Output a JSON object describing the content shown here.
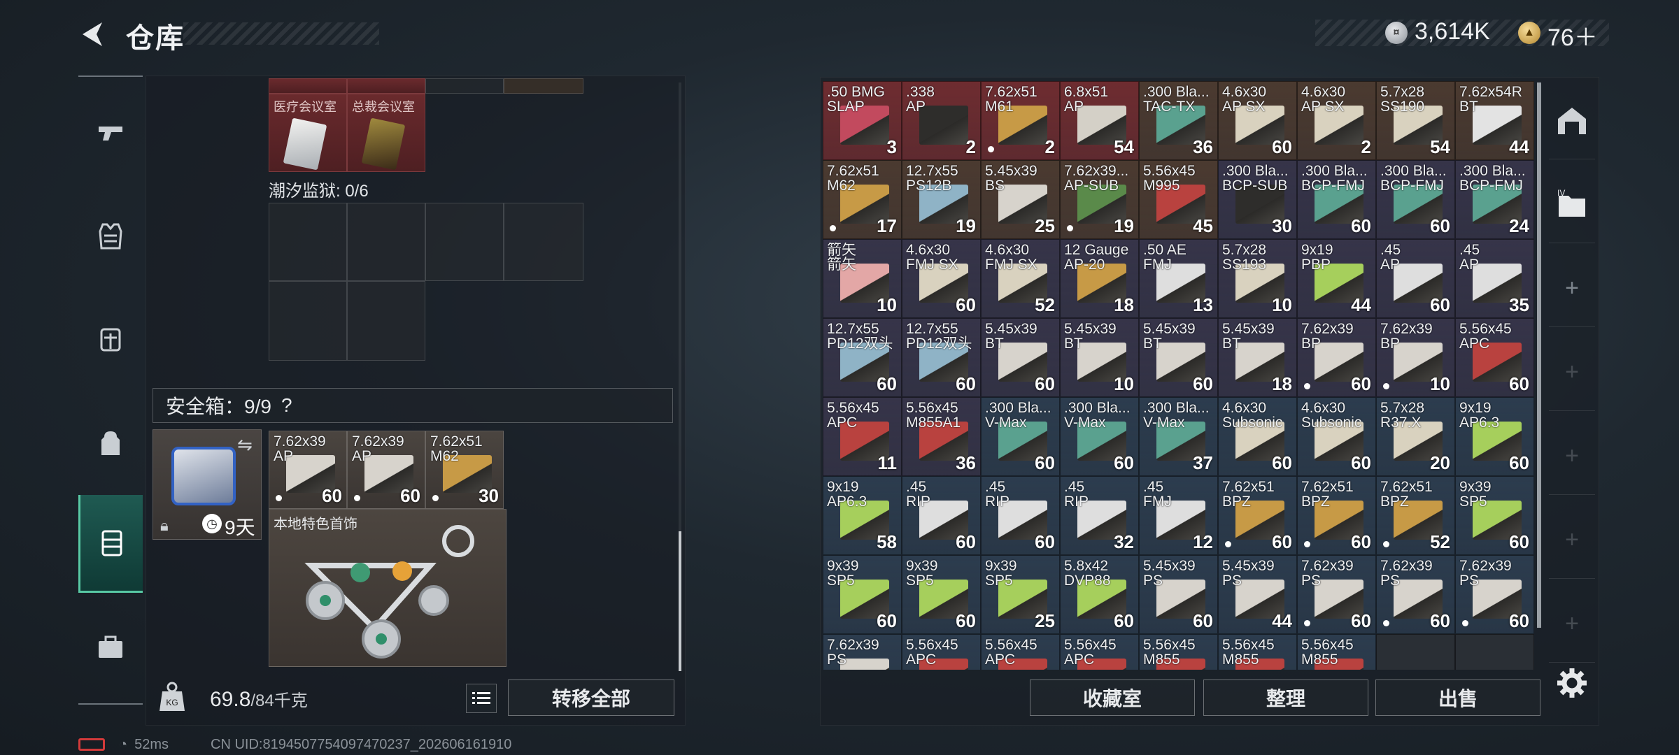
{
  "header": {
    "title": "仓库",
    "silver_value": "3,614K",
    "gold_value": "76＋"
  },
  "left": {
    "rooms": [
      {
        "label": "医疗会议室"
      },
      {
        "label": "总裁会议室"
      }
    ],
    "prison_label": "潮汐监狱: 0/6",
    "safebox_label": "安全箱：9/9",
    "safebox_help": "?",
    "safebox_timer": "9天",
    "safebox_items": [
      {
        "name": "7.62x39\nAP",
        "count": "60",
        "dot": true,
        "color": "#d7d3cc"
      },
      {
        "name": "7.62x39\nAP",
        "count": "60",
        "dot": true,
        "color": "#d7d3cc"
      },
      {
        "name": "7.62x51\nM62",
        "count": "30",
        "dot": true,
        "color": "#c79a46"
      }
    ],
    "trinket_label": "本地特色首饰",
    "weight_value": "69.8",
    "weight_max": "/84千克",
    "transfer_all": "转移全部"
  },
  "stash": {
    "rows": [
      [
        {
          "name": ".50 BMG\nSLAP",
          "count": "3",
          "bg": "#6e2c30",
          "box": "#c24a5e",
          "dot": false
        },
        {
          "name": ".338\nAP",
          "count": "2",
          "bg": "#6e2c30",
          "box": "#2e2d2b",
          "dot": false
        },
        {
          "name": "7.62x51\nM61",
          "count": "2",
          "bg": "#6e2c30",
          "box": "#c79a46",
          "dot": true
        },
        {
          "name": "6.8x51\nAP",
          "count": "54",
          "bg": "#6e2c30",
          "box": "#d4d0c7",
          "dot": false
        },
        {
          "name": ".300 Bla...\nTAC-TX",
          "count": "36",
          "bg": "#4b3a30",
          "box": "#5aa18f",
          "dot": false
        },
        {
          "name": "4.6x30\nAP SX",
          "count": "60",
          "bg": "#4b3a30",
          "box": "#d9d2bf",
          "dot": false
        },
        {
          "name": "4.6x30\nAP SX",
          "count": "2",
          "bg": "#4b3a30",
          "box": "#d9d2bf",
          "dot": false
        },
        {
          "name": "5.7x28\nSS190",
          "count": "54",
          "bg": "#4b3a30",
          "box": "#d9d2bf",
          "dot": false
        },
        {
          "name": "7.62x54R\nBT",
          "count": "44",
          "bg": "#4b3a30",
          "box": "#e3e3e3",
          "dot": false
        }
      ],
      [
        {
          "name": "7.62x51\nM62",
          "count": "17",
          "bg": "#4b3a30",
          "box": "#c79a46",
          "dot": true
        },
        {
          "name": "12.7x55\nPS12B",
          "count": "19",
          "bg": "#4b3a30",
          "box": "#8fb3c6",
          "dot": false
        },
        {
          "name": "5.45x39\nBS",
          "count": "25",
          "bg": "#4b3a30",
          "box": "#d7d3cc",
          "dot": false
        },
        {
          "name": "7.62x39...\nAP-SUB",
          "count": "19",
          "bg": "#4b3a30",
          "box": "#5a8a4a",
          "dot": true
        },
        {
          "name": "5.56x45\nM995",
          "count": "45",
          "bg": "#4b3a30",
          "box": "#b9423f",
          "dot": false
        },
        {
          "name": ".300 Bla...\nBCP-SUB",
          "count": "30",
          "bg": "#363449",
          "box": "#2e2d2b",
          "dot": false
        },
        {
          "name": ".300 Bla...\nBCP-FMJ",
          "count": "60",
          "bg": "#363449",
          "box": "#5aa18f",
          "dot": false
        },
        {
          "name": ".300 Bla...\nBCP-FMJ",
          "count": "60",
          "bg": "#363449",
          "box": "#5aa18f",
          "dot": false
        },
        {
          "name": ".300 Bla...\nBCP-FMJ",
          "count": "24",
          "bg": "#363449",
          "box": "#5aa18f",
          "dot": false
        }
      ],
      [
        {
          "name": "箭矢\n箭矢",
          "count": "10",
          "bg": "#363449",
          "box": "#e3a7a6",
          "dot": false
        },
        {
          "name": "4.6x30\nFMJ SX",
          "count": "60",
          "bg": "#363449",
          "box": "#d9d2bf",
          "dot": false
        },
        {
          "name": "4.6x30\nFMJ SX",
          "count": "52",
          "bg": "#363449",
          "box": "#d9d2bf",
          "dot": false
        },
        {
          "name": "12 Gauge\nAP-20",
          "count": "18",
          "bg": "#363449",
          "box": "#c79a46",
          "dot": false
        },
        {
          "name": ".50 AE\nFMJ",
          "count": "13",
          "bg": "#363449",
          "box": "#dedede",
          "dot": false
        },
        {
          "name": "5.7x28\nSS193",
          "count": "10",
          "bg": "#363449",
          "box": "#d9d2bf",
          "dot": false
        },
        {
          "name": "9x19\nPBP",
          "count": "44",
          "bg": "#363449",
          "box": "#a6cf5c",
          "dot": false
        },
        {
          "name": ".45\nAP",
          "count": "60",
          "bg": "#363449",
          "box": "#dedede",
          "dot": false
        },
        {
          "name": ".45\nAP",
          "count": "35",
          "bg": "#363449",
          "box": "#dedede",
          "dot": false
        }
      ],
      [
        {
          "name": "12.7x55\nPD12双头",
          "count": "60",
          "bg": "#363449",
          "box": "#8fb3c6",
          "dot": false
        },
        {
          "name": "12.7x55\nPD12双头",
          "count": "60",
          "bg": "#363449",
          "box": "#8fb3c6",
          "dot": false
        },
        {
          "name": "5.45x39\nBT",
          "count": "60",
          "bg": "#363449",
          "box": "#d7d3cc",
          "dot": false
        },
        {
          "name": "5.45x39\nBT",
          "count": "10",
          "bg": "#363449",
          "box": "#d7d3cc",
          "dot": false
        },
        {
          "name": "5.45x39\nBT",
          "count": "60",
          "bg": "#363449",
          "box": "#d7d3cc",
          "dot": false
        },
        {
          "name": "5.45x39\nBT",
          "count": "18",
          "bg": "#363449",
          "box": "#d7d3cc",
          "dot": false
        },
        {
          "name": "7.62x39\nBP",
          "count": "60",
          "bg": "#363449",
          "box": "#d7d3cc",
          "dot": true
        },
        {
          "name": "7.62x39\nBP",
          "count": "10",
          "bg": "#363449",
          "box": "#d7d3cc",
          "dot": true
        },
        {
          "name": "5.56x45\nAPC",
          "count": "60",
          "bg": "#363449",
          "box": "#b9423f",
          "dot": false
        }
      ],
      [
        {
          "name": "5.56x45\nAPC",
          "count": "11",
          "bg": "#363449",
          "box": "#b9423f",
          "dot": false
        },
        {
          "name": "5.56x45\nM855A1",
          "count": "36",
          "bg": "#363449",
          "box": "#b9423f",
          "dot": false
        },
        {
          "name": ".300 Bla...\nV-Max",
          "count": "60",
          "bg": "#2c3c4e",
          "box": "#5aa18f",
          "dot": false
        },
        {
          "name": ".300 Bla...\nV-Max",
          "count": "60",
          "bg": "#2c3c4e",
          "box": "#5aa18f",
          "dot": false
        },
        {
          "name": ".300 Bla...\nV-Max",
          "count": "37",
          "bg": "#2c3c4e",
          "box": "#5aa18f",
          "dot": false
        },
        {
          "name": "4.6x30\nSubsonic",
          "count": "60",
          "bg": "#2c3c4e",
          "box": "#d9d2bf",
          "dot": false
        },
        {
          "name": "4.6x30\nSubsonic",
          "count": "60",
          "bg": "#2c3c4e",
          "box": "#d9d2bf",
          "dot": false
        },
        {
          "name": "5.7x28\nR37.X",
          "count": "20",
          "bg": "#2c3c4e",
          "box": "#d9d2bf",
          "dot": false
        },
        {
          "name": "9x19\nAP6.3",
          "count": "60",
          "bg": "#2c3c4e",
          "box": "#a6cf5c",
          "dot": false
        }
      ],
      [
        {
          "name": "9x19\nAP6.3",
          "count": "58",
          "bg": "#2c3c4e",
          "box": "#a6cf5c",
          "dot": false
        },
        {
          "name": ".45\nRIP",
          "count": "60",
          "bg": "#2c3c4e",
          "box": "#dedede",
          "dot": false
        },
        {
          "name": ".45\nRIP",
          "count": "60",
          "bg": "#2c3c4e",
          "box": "#dedede",
          "dot": false
        },
        {
          "name": ".45\nRIP",
          "count": "32",
          "bg": "#2c3c4e",
          "box": "#dedede",
          "dot": false
        },
        {
          "name": ".45\nFMJ",
          "count": "12",
          "bg": "#2c3c4e",
          "box": "#dedede",
          "dot": false
        },
        {
          "name": "7.62x51\nBPZ",
          "count": "60",
          "bg": "#2c3c4e",
          "box": "#c79a46",
          "dot": true
        },
        {
          "name": "7.62x51\nBPZ",
          "count": "60",
          "bg": "#2c3c4e",
          "box": "#c79a46",
          "dot": true
        },
        {
          "name": "7.62x51\nBPZ",
          "count": "52",
          "bg": "#2c3c4e",
          "box": "#c79a46",
          "dot": true
        },
        {
          "name": "9x39\nSP5",
          "count": "60",
          "bg": "#2c3c4e",
          "box": "#a6cf5c",
          "dot": false
        }
      ],
      [
        {
          "name": "9x39\nSP5",
          "count": "60",
          "bg": "#2c3c4e",
          "box": "#a6cf5c",
          "dot": false
        },
        {
          "name": "9x39\nSP5",
          "count": "60",
          "bg": "#2c3c4e",
          "box": "#a6cf5c",
          "dot": false
        },
        {
          "name": "9x39\nSP5",
          "count": "25",
          "bg": "#2c3c4e",
          "box": "#a6cf5c",
          "dot": false
        },
        {
          "name": "5.8x42\nDVP88",
          "count": "60",
          "bg": "#2c3c4e",
          "box": "#a6cf5c",
          "dot": false
        },
        {
          "name": "5.45x39\nPS",
          "count": "60",
          "bg": "#2c3c4e",
          "box": "#d7d3cc",
          "dot": false
        },
        {
          "name": "5.45x39\nPS",
          "count": "44",
          "bg": "#2c3c4e",
          "box": "#d7d3cc",
          "dot": false
        },
        {
          "name": "7.62x39\nPS",
          "count": "60",
          "bg": "#2c3c4e",
          "box": "#d7d3cc",
          "dot": true
        },
        {
          "name": "7.62x39\nPS",
          "count": "60",
          "bg": "#2c3c4e",
          "box": "#d7d3cc",
          "dot": true
        },
        {
          "name": "7.62x39\nPS",
          "count": "60",
          "bg": "#2c3c4e",
          "box": "#d7d3cc",
          "dot": true
        }
      ],
      [
        {
          "name": "7.62x39\nPS",
          "count": "",
          "bg": "#2c3c4e",
          "box": "#d7d3cc",
          "dot": false
        },
        {
          "name": "5.56x45\nAPC",
          "count": "",
          "bg": "#2c3c4e",
          "box": "#b9423f",
          "dot": false
        },
        {
          "name": "5.56x45\nAPC",
          "count": "",
          "bg": "#2c3c4e",
          "box": "#b9423f",
          "dot": false
        },
        {
          "name": "5.56x45\nAPC",
          "count": "",
          "bg": "#2c3c4e",
          "box": "#b9423f",
          "dot": false
        },
        {
          "name": "5.56x45\nM855",
          "count": "",
          "bg": "#2c3c4e",
          "box": "#b9423f",
          "dot": false
        },
        {
          "name": "5.56x45\nM855",
          "count": "",
          "bg": "#2c3c4e",
          "box": "#b9423f",
          "dot": false
        },
        {
          "name": "5.56x45\nM855",
          "count": "",
          "bg": "#2c3c4e",
          "box": "#b9423f",
          "dot": false
        }
      ]
    ],
    "buttons": {
      "collection": "收藏室",
      "sort": "整理",
      "sell": "出售"
    }
  },
  "status": {
    "ping": "52ms",
    "uid": "CN UID:8194507754097470237_202606161910"
  }
}
